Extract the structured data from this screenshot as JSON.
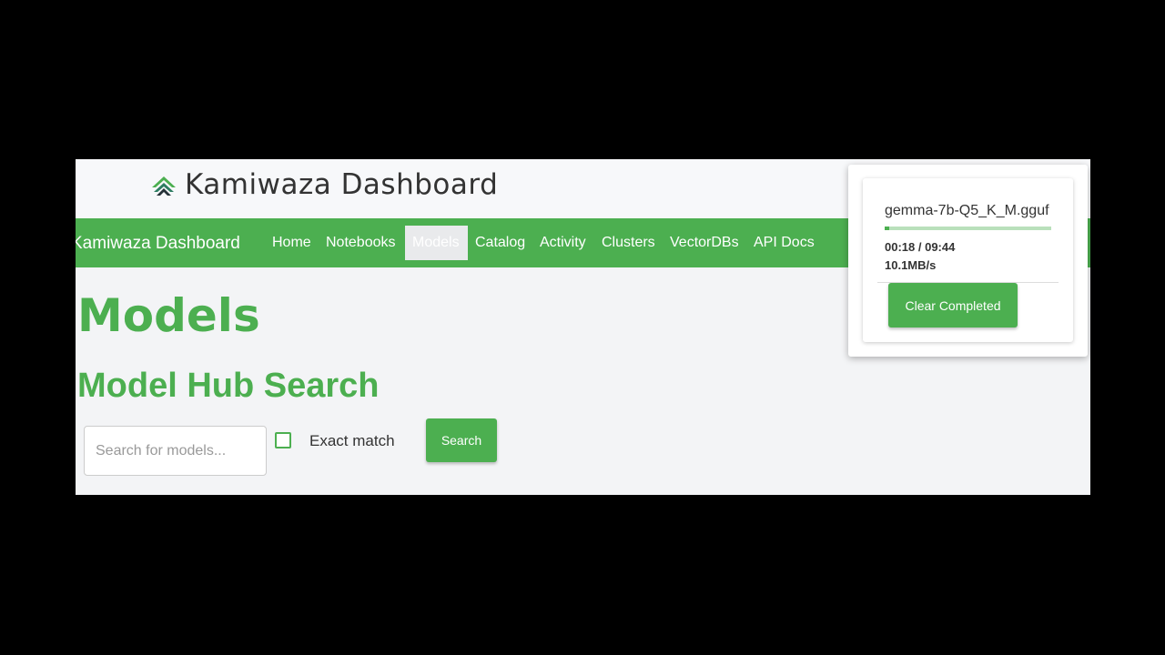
{
  "header": {
    "logo_icon": "kamiwaza-logo-icon",
    "title": "Kamiwaza Dashboard"
  },
  "nav": {
    "brand": "Kamiwaza Dashboard",
    "links": [
      {
        "label": "Home",
        "active": false
      },
      {
        "label": "Notebooks",
        "active": false
      },
      {
        "label": "Models",
        "active": true
      },
      {
        "label": "Catalog",
        "active": false
      },
      {
        "label": "Activity",
        "active": false
      },
      {
        "label": "Clusters",
        "active": false
      },
      {
        "label": "VectorDBs",
        "active": false
      },
      {
        "label": "API Docs",
        "active": false
      }
    ]
  },
  "main": {
    "page_title": "Models",
    "section_title": "Model Hub Search",
    "search": {
      "placeholder": "Search for models...",
      "value": ""
    },
    "exact_match": {
      "label": "Exact match",
      "checked": false
    },
    "search_button": "Search"
  },
  "downloads": {
    "items": [
      {
        "filename": "gemma-7b-Q5_K_M.gguf",
        "progress": 0.03,
        "time": "00:18 / 09:44",
        "speed": "10.1MB/s"
      }
    ],
    "clear_button": "Clear Completed"
  },
  "colors": {
    "accent": "#4caf50",
    "progress_track": "#b9e0bb",
    "background": "#f3f4f6"
  }
}
